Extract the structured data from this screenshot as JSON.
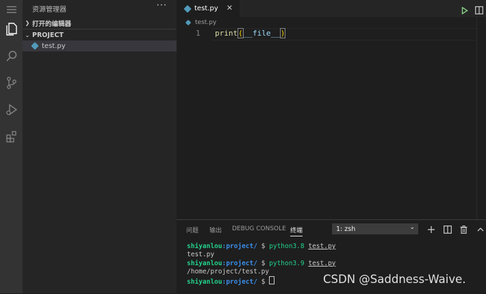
{
  "activity_bar": {
    "items": [
      "menu",
      "explorer",
      "search",
      "source-control",
      "run-debug",
      "extensions"
    ]
  },
  "sidebar": {
    "title": "资源管理器",
    "more": "···",
    "open_editors_label": "打开的编辑器",
    "project_label": "PROJECT",
    "files": [
      {
        "name": "test.py",
        "selected": true
      }
    ]
  },
  "editor": {
    "tab": {
      "name": "test.py",
      "close": "✕"
    },
    "breadcrumb": "test.py",
    "lines": [
      {
        "number": "1",
        "fn": "print",
        "open": "(",
        "arg": "__file__",
        "close": ")"
      }
    ]
  },
  "panel": {
    "tabs": [
      "问题",
      "输出",
      "DEBUG CONSOLE",
      "终端"
    ],
    "active_tab": "终端",
    "terminal_select": "1: zsh",
    "terminal": [
      {
        "user": "shiyanlou",
        "path": ":project/",
        "prompt": " $ ",
        "cmd": "python3.8",
        "arg": "test.py"
      },
      {
        "output": "test.py"
      },
      {
        "user": "shiyanlou",
        "path": ":project/",
        "prompt": " $ ",
        "cmd": "python3.9",
        "arg": "test.py"
      },
      {
        "output": "/home/project/test.py"
      },
      {
        "user": "shiyanlou",
        "path": ":project/",
        "prompt": " $ "
      }
    ]
  },
  "watermark": "CSDN @Saddness-Waive.",
  "colors": {
    "activity_bar": "#333333",
    "sidebar": "#252526",
    "editor_bg": "#1e1e1e",
    "python_icon": "#519aba",
    "run_green": "#89d185",
    "prompt_green": "#23d18b",
    "prompt_blue": "#3b8eea"
  }
}
